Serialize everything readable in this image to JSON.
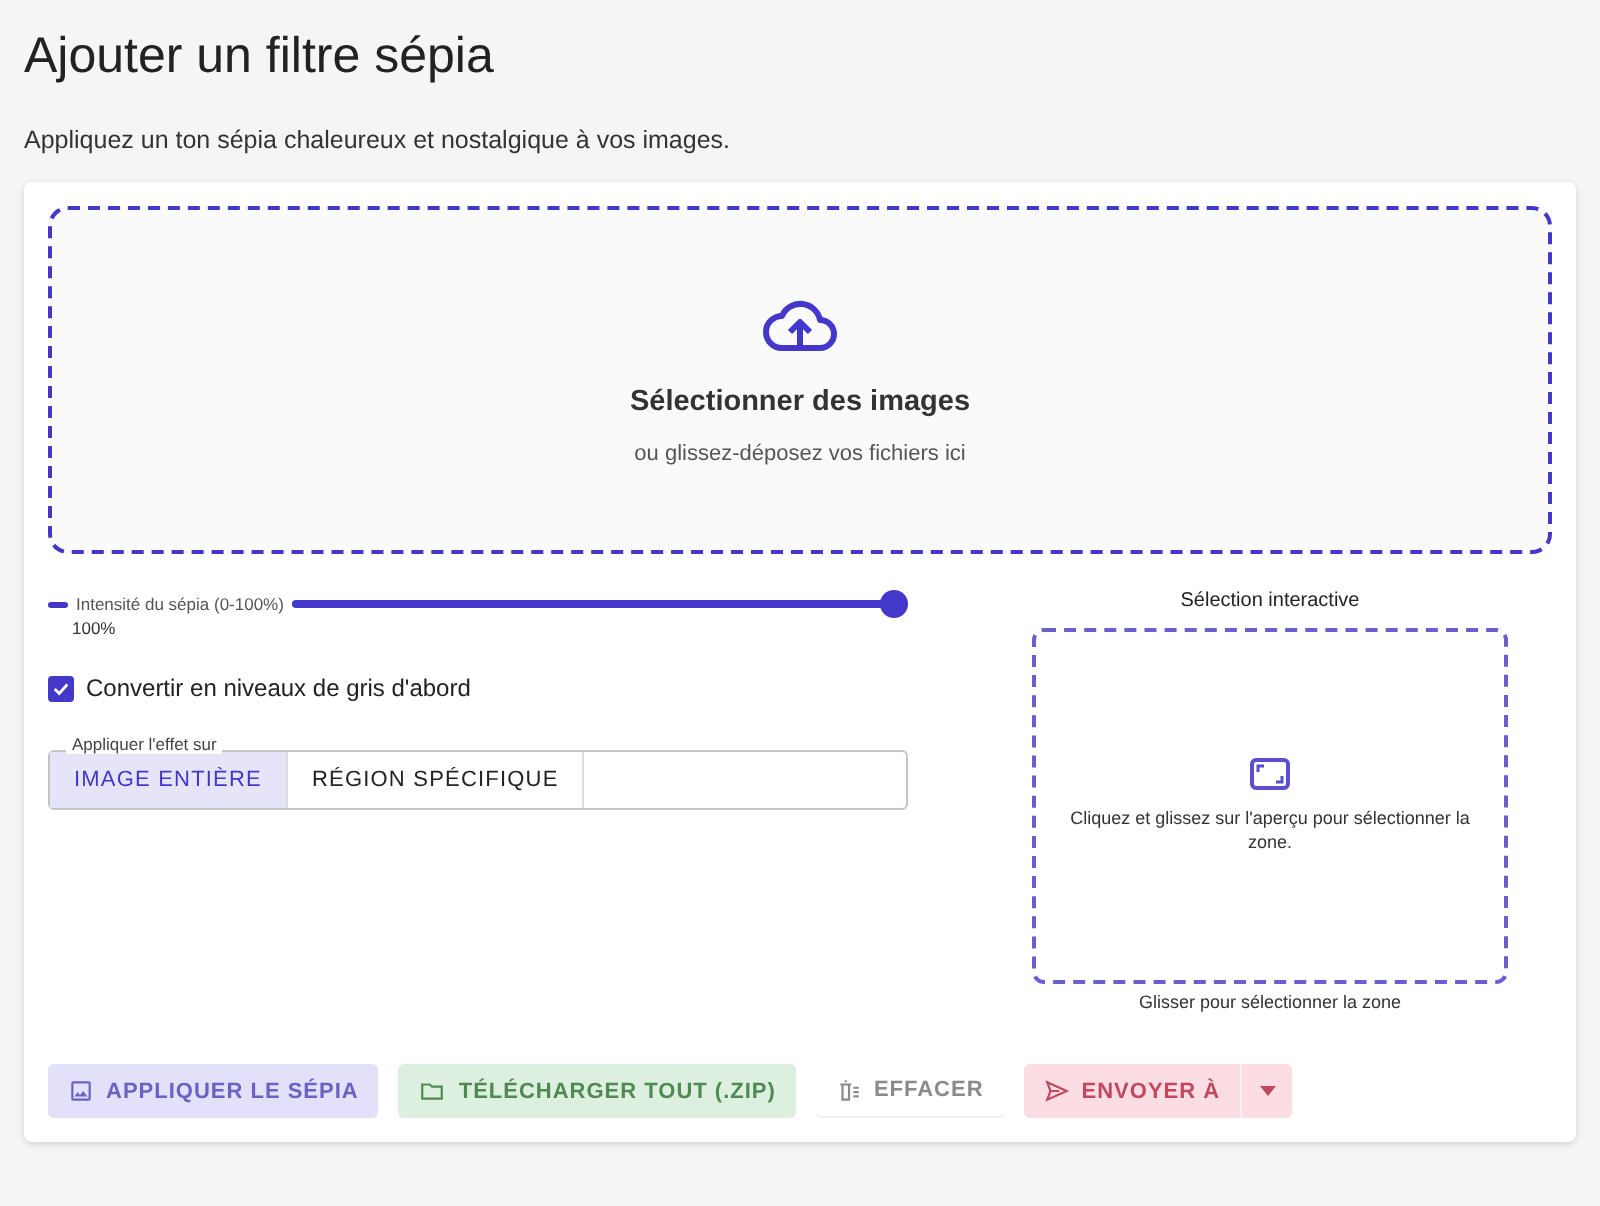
{
  "title": "Ajouter un filtre sépia",
  "subtitle": "Appliquez un ton sépia chaleureux et nostalgique à vos images.",
  "dropzone": {
    "title": "Sélectionner des images",
    "hint": "ou glissez-déposez vos fichiers ici"
  },
  "slider": {
    "label": "Intensité du sépia (0-100%)",
    "reading": "100%",
    "level": 1
  },
  "checkbox": {
    "label": "Convertir en niveaux de gris d'abord",
    "checked": true
  },
  "apply_to": {
    "legend": "Appliquer l'effet sur",
    "options": [
      {
        "label": "IMAGE ENTIÈRE",
        "selected": true
      },
      {
        "label": "RÉGION SPÉCIFIQUE",
        "selected": false
      }
    ]
  },
  "selection": {
    "title": "Sélection interactive",
    "hint": "Cliquez et glissez sur l'aperçu pour sélectionner la zone.",
    "caption": "Glisser pour sélectionner la zone"
  },
  "buttons": [
    {
      "label": "APPLIQUER LE SÉPIA",
      "kind": "primary",
      "disabled": true
    },
    {
      "label": "TÉLÉCHARGER TOUT (.ZIP)",
      "kind": "success",
      "disabled": true
    },
    {
      "label": "EFFACER",
      "kind": "text",
      "disabled": true
    },
    {
      "label": "ENVOYER À",
      "kind": "danger",
      "disabled": true,
      "split": true
    }
  ]
}
